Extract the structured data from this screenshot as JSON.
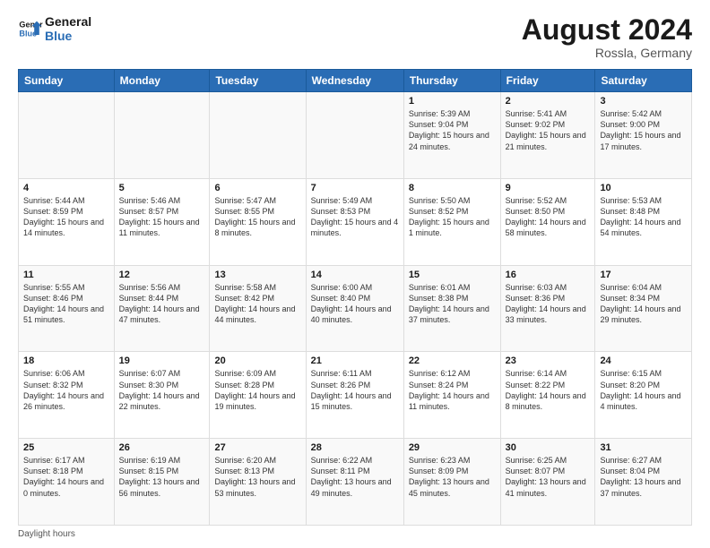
{
  "header": {
    "logo_line1": "General",
    "logo_line2": "Blue",
    "month_year": "August 2024",
    "location": "Rossla, Germany"
  },
  "days_of_week": [
    "Sunday",
    "Monday",
    "Tuesday",
    "Wednesday",
    "Thursday",
    "Friday",
    "Saturday"
  ],
  "weeks": [
    [
      {
        "num": "",
        "sunrise": "",
        "sunset": "",
        "daylight": ""
      },
      {
        "num": "",
        "sunrise": "",
        "sunset": "",
        "daylight": ""
      },
      {
        "num": "",
        "sunrise": "",
        "sunset": "",
        "daylight": ""
      },
      {
        "num": "",
        "sunrise": "",
        "sunset": "",
        "daylight": ""
      },
      {
        "num": "1",
        "sunrise": "Sunrise: 5:39 AM",
        "sunset": "Sunset: 9:04 PM",
        "daylight": "Daylight: 15 hours and 24 minutes."
      },
      {
        "num": "2",
        "sunrise": "Sunrise: 5:41 AM",
        "sunset": "Sunset: 9:02 PM",
        "daylight": "Daylight: 15 hours and 21 minutes."
      },
      {
        "num": "3",
        "sunrise": "Sunrise: 5:42 AM",
        "sunset": "Sunset: 9:00 PM",
        "daylight": "Daylight: 15 hours and 17 minutes."
      }
    ],
    [
      {
        "num": "4",
        "sunrise": "Sunrise: 5:44 AM",
        "sunset": "Sunset: 8:59 PM",
        "daylight": "Daylight: 15 hours and 14 minutes."
      },
      {
        "num": "5",
        "sunrise": "Sunrise: 5:46 AM",
        "sunset": "Sunset: 8:57 PM",
        "daylight": "Daylight: 15 hours and 11 minutes."
      },
      {
        "num": "6",
        "sunrise": "Sunrise: 5:47 AM",
        "sunset": "Sunset: 8:55 PM",
        "daylight": "Daylight: 15 hours and 8 minutes."
      },
      {
        "num": "7",
        "sunrise": "Sunrise: 5:49 AM",
        "sunset": "Sunset: 8:53 PM",
        "daylight": "Daylight: 15 hours and 4 minutes."
      },
      {
        "num": "8",
        "sunrise": "Sunrise: 5:50 AM",
        "sunset": "Sunset: 8:52 PM",
        "daylight": "Daylight: 15 hours and 1 minute."
      },
      {
        "num": "9",
        "sunrise": "Sunrise: 5:52 AM",
        "sunset": "Sunset: 8:50 PM",
        "daylight": "Daylight: 14 hours and 58 minutes."
      },
      {
        "num": "10",
        "sunrise": "Sunrise: 5:53 AM",
        "sunset": "Sunset: 8:48 PM",
        "daylight": "Daylight: 14 hours and 54 minutes."
      }
    ],
    [
      {
        "num": "11",
        "sunrise": "Sunrise: 5:55 AM",
        "sunset": "Sunset: 8:46 PM",
        "daylight": "Daylight: 14 hours and 51 minutes."
      },
      {
        "num": "12",
        "sunrise": "Sunrise: 5:56 AM",
        "sunset": "Sunset: 8:44 PM",
        "daylight": "Daylight: 14 hours and 47 minutes."
      },
      {
        "num": "13",
        "sunrise": "Sunrise: 5:58 AM",
        "sunset": "Sunset: 8:42 PM",
        "daylight": "Daylight: 14 hours and 44 minutes."
      },
      {
        "num": "14",
        "sunrise": "Sunrise: 6:00 AM",
        "sunset": "Sunset: 8:40 PM",
        "daylight": "Daylight: 14 hours and 40 minutes."
      },
      {
        "num": "15",
        "sunrise": "Sunrise: 6:01 AM",
        "sunset": "Sunset: 8:38 PM",
        "daylight": "Daylight: 14 hours and 37 minutes."
      },
      {
        "num": "16",
        "sunrise": "Sunrise: 6:03 AM",
        "sunset": "Sunset: 8:36 PM",
        "daylight": "Daylight: 14 hours and 33 minutes."
      },
      {
        "num": "17",
        "sunrise": "Sunrise: 6:04 AM",
        "sunset": "Sunset: 8:34 PM",
        "daylight": "Daylight: 14 hours and 29 minutes."
      }
    ],
    [
      {
        "num": "18",
        "sunrise": "Sunrise: 6:06 AM",
        "sunset": "Sunset: 8:32 PM",
        "daylight": "Daylight: 14 hours and 26 minutes."
      },
      {
        "num": "19",
        "sunrise": "Sunrise: 6:07 AM",
        "sunset": "Sunset: 8:30 PM",
        "daylight": "Daylight: 14 hours and 22 minutes."
      },
      {
        "num": "20",
        "sunrise": "Sunrise: 6:09 AM",
        "sunset": "Sunset: 8:28 PM",
        "daylight": "Daylight: 14 hours and 19 minutes."
      },
      {
        "num": "21",
        "sunrise": "Sunrise: 6:11 AM",
        "sunset": "Sunset: 8:26 PM",
        "daylight": "Daylight: 14 hours and 15 minutes."
      },
      {
        "num": "22",
        "sunrise": "Sunrise: 6:12 AM",
        "sunset": "Sunset: 8:24 PM",
        "daylight": "Daylight: 14 hours and 11 minutes."
      },
      {
        "num": "23",
        "sunrise": "Sunrise: 6:14 AM",
        "sunset": "Sunset: 8:22 PM",
        "daylight": "Daylight: 14 hours and 8 minutes."
      },
      {
        "num": "24",
        "sunrise": "Sunrise: 6:15 AM",
        "sunset": "Sunset: 8:20 PM",
        "daylight": "Daylight: 14 hours and 4 minutes."
      }
    ],
    [
      {
        "num": "25",
        "sunrise": "Sunrise: 6:17 AM",
        "sunset": "Sunset: 8:18 PM",
        "daylight": "Daylight: 14 hours and 0 minutes."
      },
      {
        "num": "26",
        "sunrise": "Sunrise: 6:19 AM",
        "sunset": "Sunset: 8:15 PM",
        "daylight": "Daylight: 13 hours and 56 minutes."
      },
      {
        "num": "27",
        "sunrise": "Sunrise: 6:20 AM",
        "sunset": "Sunset: 8:13 PM",
        "daylight": "Daylight: 13 hours and 53 minutes."
      },
      {
        "num": "28",
        "sunrise": "Sunrise: 6:22 AM",
        "sunset": "Sunset: 8:11 PM",
        "daylight": "Daylight: 13 hours and 49 minutes."
      },
      {
        "num": "29",
        "sunrise": "Sunrise: 6:23 AM",
        "sunset": "Sunset: 8:09 PM",
        "daylight": "Daylight: 13 hours and 45 minutes."
      },
      {
        "num": "30",
        "sunrise": "Sunrise: 6:25 AM",
        "sunset": "Sunset: 8:07 PM",
        "daylight": "Daylight: 13 hours and 41 minutes."
      },
      {
        "num": "31",
        "sunrise": "Sunrise: 6:27 AM",
        "sunset": "Sunset: 8:04 PM",
        "daylight": "Daylight: 13 hours and 37 minutes."
      }
    ]
  ],
  "footer": {
    "note": "Daylight hours"
  }
}
